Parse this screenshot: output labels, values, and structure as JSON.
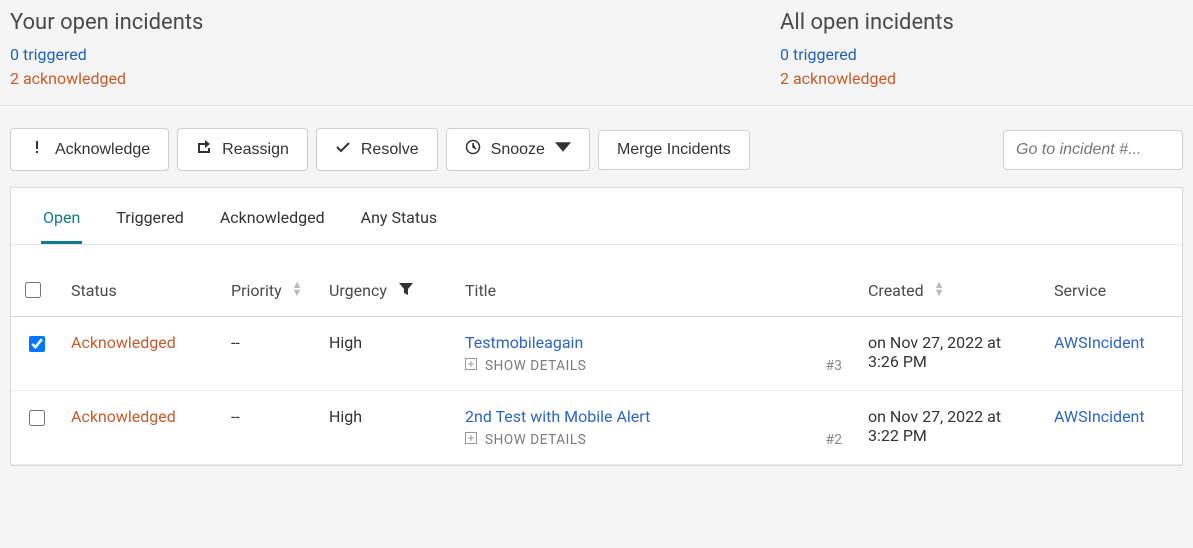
{
  "summary": {
    "yours": {
      "title": "Your open incidents",
      "triggered": "0 triggered",
      "acknowledged": "2 acknowledged"
    },
    "all": {
      "title": "All open incidents",
      "triggered": "0 triggered",
      "acknowledged": "2 acknowledged"
    }
  },
  "toolbar": {
    "acknowledge": "Acknowledge",
    "reassign": "Reassign",
    "resolve": "Resolve",
    "snooze": "Snooze",
    "merge": "Merge Incidents",
    "goto_placeholder": "Go to incident #..."
  },
  "tabs": {
    "open": "Open",
    "triggered": "Triggered",
    "acknowledged": "Acknowledged",
    "any": "Any Status"
  },
  "columns": {
    "status": "Status",
    "priority": "Priority",
    "urgency": "Urgency",
    "title": "Title",
    "created": "Created",
    "service": "Service"
  },
  "details_label": "SHOW DETAILS",
  "rows": [
    {
      "checked": true,
      "status": "Acknowledged",
      "priority": "--",
      "urgency": "High",
      "title": "Testmobileagain",
      "num": "#3",
      "created": "on Nov 27, 2022 at 3:26 PM",
      "service": "AWSIncident"
    },
    {
      "checked": false,
      "status": "Acknowledged",
      "priority": "--",
      "urgency": "High",
      "title": "2nd Test with Mobile Alert",
      "num": "#2",
      "created": "on Nov 27, 2022 at 3:22 PM",
      "service": "AWSIncident"
    }
  ]
}
